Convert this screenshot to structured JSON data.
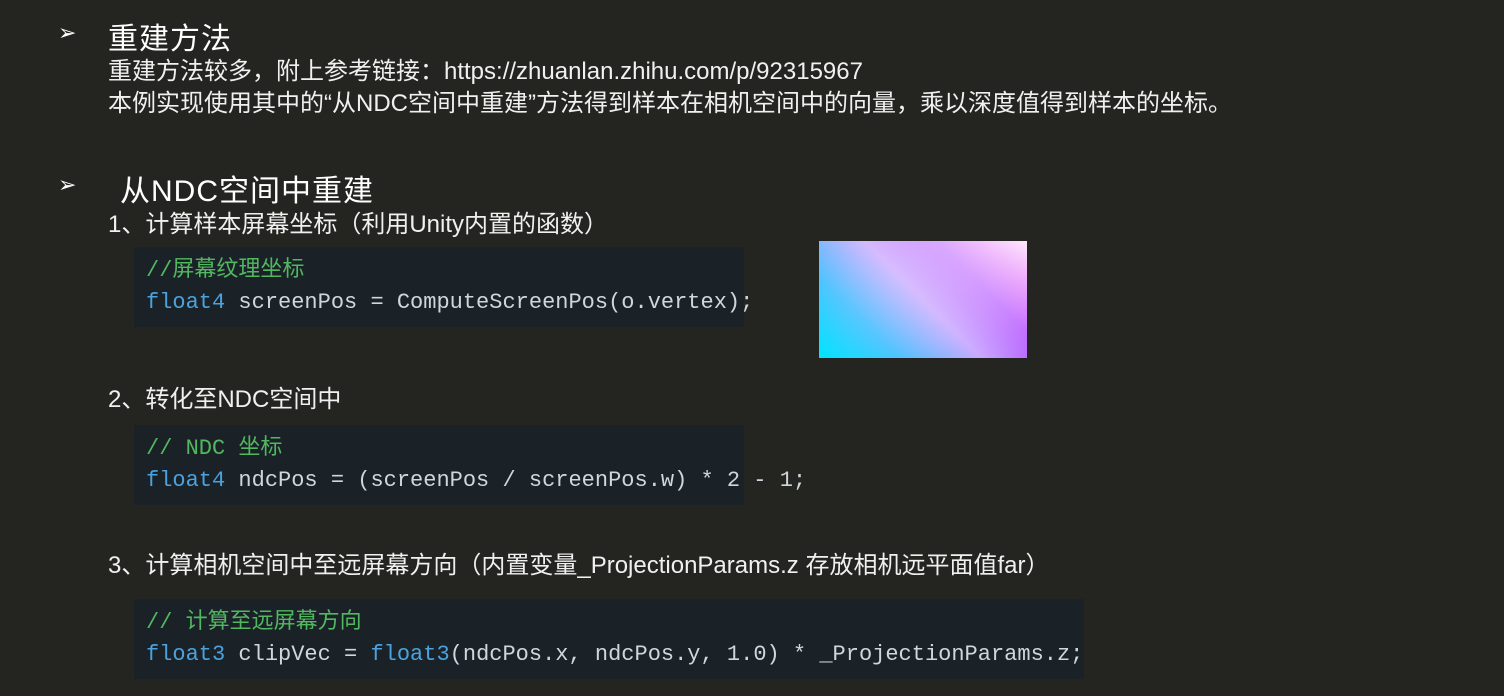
{
  "section1": {
    "bullet": "➢",
    "heading": "重建方法",
    "line1": "重建方法较多，附上参考链接：https://zhuanlan.zhihu.com/p/92315967",
    "line2": "本例实现使用其中的“从NDC空间中重建”方法得到样本在相机空间中的向量，乘以深度值得到样本的坐标。"
  },
  "section2": {
    "bullet": "➢",
    "heading": "从NDC空间中重建",
    "step1": "1、计算样本屏幕坐标（利用Unity内置的函数）",
    "code1": {
      "c1": "//屏幕纹理坐标",
      "t1": "float4",
      "r1": " screenPos = ComputeScreenPos(o.vertex);"
    },
    "step2": "2、转化至NDC空间中",
    "code2": {
      "c1": "// NDC 坐标",
      "t1": "float4",
      "r1": " ndcPos = (screenPos / screenPos.w) * 2 - 1;"
    },
    "step3": "3、计算相机空间中至远屏幕方向（内置变量_ProjectionParams.z 存放相机远平面值far）",
    "code3": {
      "c1": "// 计算至远屏幕方向",
      "t1": "float3",
      "r1": " clipVec = ",
      "t2": "float3",
      "r2": "(ndcPos.x, ndcPos.y, 1.0) * _ProjectionParams.z;"
    }
  }
}
